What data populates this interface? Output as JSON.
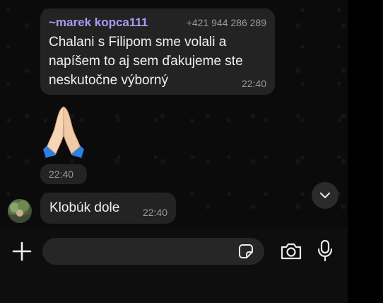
{
  "message1": {
    "sender_name": "~marek kopca111",
    "sender_phone": "+421 944 286 289",
    "text": "Chalani s Filipom sme volali a\nnapíšem to aj sem ďakujeme ste\nneskutočne výborný",
    "time": "22:40"
  },
  "emoji_message": {
    "emoji": "folded-hands",
    "time": "22:40"
  },
  "message2": {
    "text": "Klobúk dole",
    "time": "22:40"
  },
  "input": {
    "placeholder": "",
    "value": ""
  },
  "icons": {
    "plus": "plus-icon",
    "sticker": "sticker-icon",
    "camera": "camera-icon",
    "mic": "microphone-icon",
    "scroll": "chevron-down-icon"
  },
  "colors": {
    "sender_name": "#a79cf2",
    "bubble": "#232323",
    "background": "#0b0b0b"
  }
}
